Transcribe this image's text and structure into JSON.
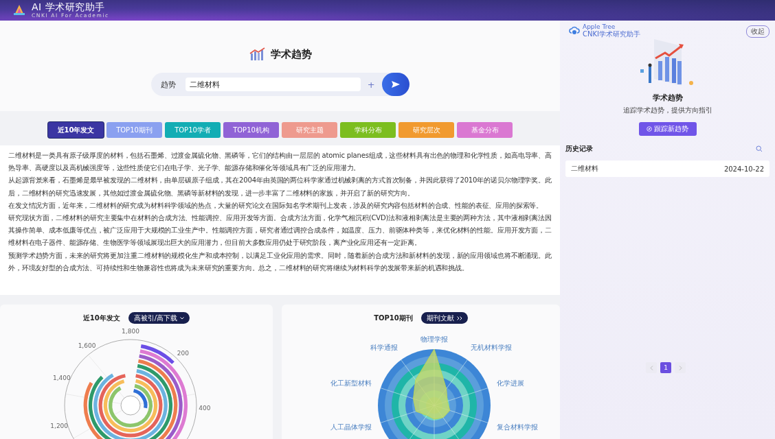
{
  "header": {
    "title": "AI 学术研究助手",
    "subtitle": "CNKI AI For Academic"
  },
  "hero": {
    "title": "学术趋势",
    "search": {
      "label": "趋势",
      "value": "二维材料",
      "add_symbol": "+"
    }
  },
  "tabs": [
    {
      "label": "近10年发文",
      "selected": true,
      "color": "#3b36a3"
    },
    {
      "label": "TOP10期刊",
      "selected": false,
      "color": "#8aa0f0"
    },
    {
      "label": "TOP10学者",
      "selected": false,
      "color": "#12adb4"
    },
    {
      "label": "TOP10机构",
      "selected": false,
      "color": "#9063d6"
    },
    {
      "label": "研究主题",
      "selected": false,
      "color": "#ee9a8e"
    },
    {
      "label": "学科分布",
      "selected": false,
      "color": "#7cbe1f"
    },
    {
      "label": "研究层次",
      "selected": false,
      "color": "#f19a2f"
    },
    {
      "label": "基金分布",
      "selected": false,
      "color": "#da78d2"
    }
  ],
  "summary": [
    "二维材料是一类具有原子级厚度的材料，包括石墨烯、过渡金属硫化物、黑磷等，它们的结构由一层层的 atomic planes组成，这些材料具有出色的物理和化学性质，如高电导率、高热导率、高硬度以及高机械强度等，这些性质使它们在电子学、光子学、能源存储和催化等领域具有广泛的应用潜力。",
    "从起源背景来看，石墨烯是最早被发现的二维材料，由单层碳原子组成，其在2004年由英国的两位科学家通过机械剥离的方式首次制备，并因此获得了2010年的诺贝尔物理学奖。此后，二维材料的研究迅速发展，其他如过渡金属硫化物、黑磷等新材料的发现，进一步丰富了二维材料的家族，并开启了新的研究方向。",
    "在发文情况方面，近年来，二维材料的研究成为材料科学领域的热点，大量的研究论文在国际知名学术期刊上发表，涉及的研究内容包括材料的合成、性能的表征、应用的探索等。",
    "研究现状方面，二维材料的研究主要集中在材料的合成方法、性能调控、应用开发等方面。合成方法方面，化学气相沉积(CVD)法和液相剥离法是主要的两种方法，其中液相剥离法因其操作简单、成本低廉等优点，被广泛应用于大规模的工业生产中。性能调控方面，研究者通过调控合成条件，如温度、压力、前驱体种类等，来优化材料的性能。应用开发方面，二维材料在电子器件、能源存储、生物医学等领域展现出巨大的应用潜力，但目前大多数应用仍处于研究阶段，离产业化应用还有一定距离。",
    "预测学术趋势方面，未来的研究将更加注重二维材料的规模化生产和成本控制，以满足工业化应用的需求。同时，随着新的合成方法和新材料的发现，新的应用领域也将不断涌现。此外，环境友好型的合成方法、可持续性和生物兼容性也将成为未来研究的重要方向。总之，二维材料的研究将继续为材料科学的发展带来新的机遇和挑战。"
  ],
  "cards": [
    {
      "kind": "polar",
      "title": "近10年发文",
      "button": "高被引/高下载",
      "axis_labels": [
        "1,800",
        "200",
        "400",
        "1,200",
        "1,400",
        "1,600"
      ]
    },
    {
      "kind": "radar",
      "title": "TOP10期刊",
      "button": "期刊文献",
      "axis_labels": [
        "物理学报",
        "科学通报",
        "无机材料学报",
        "化工新型材料",
        "化学进展",
        "人工晶体学报",
        "复合材料学报"
      ]
    }
  ],
  "sidebar": {
    "brand": "Apple Tree",
    "brand_sub": "CNKI学术研究助手",
    "collapse": "收起",
    "title": "学术趋势",
    "subtitle": "追踪学术趋势，提供方向指引",
    "action": "跟踪新趋势",
    "history_title": "历史记录",
    "history": [
      {
        "name": "二维材料",
        "date": "2024-10-22"
      }
    ],
    "pages": [
      {
        "label": "1",
        "selected": true
      }
    ]
  }
}
